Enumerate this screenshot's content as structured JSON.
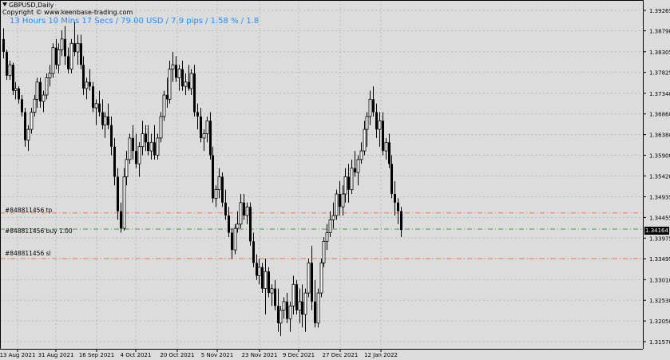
{
  "header": {
    "symbol_timeframe": "GBPUSD,Daily",
    "copyright": "Copyright © www.keenbase-trading.com",
    "timer_info": "13 Hours 10 Mins 17 Secs / 79.00 USD / 7.9 pips / 1.58 % / 1.8"
  },
  "price_axis": {
    "labels": [
      "1.39265",
      "1.38790",
      "1.38305",
      "1.37825",
      "1.37340",
      "1.36860",
      "1.36380",
      "1.35900",
      "1.35420",
      "1.34935",
      "1.34455",
      "1.33975",
      "1.33495",
      "1.33010",
      "1.32530",
      "1.32050",
      "1.31570"
    ],
    "current_price": "1.34164"
  },
  "time_axis": {
    "labels": [
      "13 Aug 2021",
      "31 Aug 2021",
      "16 Sep 2021",
      "4 Oct 2021",
      "20 Oct 2021",
      "5 Nov 2021",
      "23 Nov 2021",
      "9 Dec 2021",
      "27 Dec 2021",
      "12 Jan 2022"
    ]
  },
  "order_lines": [
    {
      "label": "#848811456 tp",
      "price": 1.3456,
      "color": "#f0784a"
    },
    {
      "label": "#848811456 buy 1.00",
      "price": 1.34185,
      "color": "#3aa53a"
    },
    {
      "label": "#848811456 sl",
      "price": 1.335,
      "color": "#f0784a"
    }
  ],
  "colors": {
    "background": "#dcdcdc",
    "grid": "#b8b8b8",
    "candle": "#000000",
    "axis": "#000000"
  },
  "chart_data": {
    "type": "candlestick",
    "symbol": "GBPUSD",
    "timeframe": "Daily",
    "ylim": [
      1.3137,
      1.3941
    ],
    "ohlc": [
      [
        1.386,
        1.3885,
        1.3815,
        1.383
      ],
      [
        1.383,
        1.3835,
        1.3765,
        1.3775
      ],
      [
        1.3775,
        1.381,
        1.3765,
        1.38
      ],
      [
        1.38,
        1.3805,
        1.373,
        1.374
      ],
      [
        1.374,
        1.376,
        1.372,
        1.3745
      ],
      [
        1.3745,
        1.375,
        1.371,
        1.372
      ],
      [
        1.372,
        1.373,
        1.368,
        1.369
      ],
      [
        1.369,
        1.37,
        1.361,
        1.3625
      ],
      [
        1.3625,
        1.366,
        1.36,
        1.365
      ],
      [
        1.365,
        1.37,
        1.364,
        1.369
      ],
      [
        1.369,
        1.373,
        1.368,
        1.372
      ],
      [
        1.372,
        1.377,
        1.37,
        1.376
      ],
      [
        1.376,
        1.377,
        1.37,
        1.3715
      ],
      [
        1.3715,
        1.374,
        1.369,
        1.373
      ],
      [
        1.373,
        1.378,
        1.372,
        1.377
      ],
      [
        1.377,
        1.38,
        1.375,
        1.378
      ],
      [
        1.378,
        1.385,
        1.377,
        1.384
      ],
      [
        1.384,
        1.386,
        1.379,
        1.38
      ],
      [
        1.38,
        1.385,
        1.378,
        1.3835
      ],
      [
        1.3835,
        1.388,
        1.382,
        1.386
      ],
      [
        1.386,
        1.389,
        1.38,
        1.382
      ],
      [
        1.382,
        1.384,
        1.378,
        1.379
      ],
      [
        1.379,
        1.386,
        1.378,
        1.385
      ],
      [
        1.385,
        1.39,
        1.382,
        1.383
      ],
      [
        1.383,
        1.387,
        1.38,
        1.385
      ],
      [
        1.385,
        1.387,
        1.379,
        1.38
      ],
      [
        1.38,
        1.382,
        1.373,
        1.3745
      ],
      [
        1.3745,
        1.377,
        1.372,
        1.376
      ],
      [
        1.376,
        1.379,
        1.374,
        1.375
      ],
      [
        1.375,
        1.376,
        1.369,
        1.37
      ],
      [
        1.37,
        1.372,
        1.366,
        1.371
      ],
      [
        1.371,
        1.374,
        1.368,
        1.369
      ],
      [
        1.369,
        1.372,
        1.365,
        1.366
      ],
      [
        1.366,
        1.369,
        1.363,
        1.368
      ],
      [
        1.368,
        1.371,
        1.365,
        1.366
      ],
      [
        1.366,
        1.368,
        1.359,
        1.361
      ],
      [
        1.361,
        1.363,
        1.352,
        1.354
      ],
      [
        1.354,
        1.356,
        1.344,
        1.346
      ],
      [
        1.346,
        1.348,
        1.341,
        1.342
      ],
      [
        1.342,
        1.356,
        1.3415,
        1.354
      ],
      [
        1.354,
        1.36,
        1.352,
        1.358
      ],
      [
        1.358,
        1.364,
        1.357,
        1.363
      ],
      [
        1.363,
        1.366,
        1.358,
        1.36
      ],
      [
        1.36,
        1.364,
        1.356,
        1.357
      ],
      [
        1.357,
        1.362,
        1.354,
        1.361
      ],
      [
        1.361,
        1.367,
        1.359,
        1.364
      ],
      [
        1.364,
        1.366,
        1.36,
        1.362
      ],
      [
        1.362,
        1.366,
        1.359,
        1.36
      ],
      [
        1.36,
        1.364,
        1.358,
        1.362
      ],
      [
        1.362,
        1.366,
        1.358,
        1.359
      ],
      [
        1.359,
        1.364,
        1.358,
        1.363
      ],
      [
        1.363,
        1.369,
        1.362,
        1.368
      ],
      [
        1.368,
        1.374,
        1.367,
        1.373
      ],
      [
        1.373,
        1.377,
        1.37,
        1.372
      ],
      [
        1.372,
        1.381,
        1.371,
        1.379
      ],
      [
        1.379,
        1.383,
        1.376,
        1.38
      ],
      [
        1.38,
        1.382,
        1.376,
        1.377
      ],
      [
        1.377,
        1.38,
        1.374,
        1.379
      ],
      [
        1.379,
        1.381,
        1.374,
        1.375
      ],
      [
        1.375,
        1.378,
        1.373,
        1.376
      ],
      [
        1.376,
        1.38,
        1.374,
        1.3745
      ],
      [
        1.3745,
        1.379,
        1.373,
        1.378
      ],
      [
        1.378,
        1.38,
        1.368,
        1.369
      ],
      [
        1.369,
        1.371,
        1.365,
        1.368
      ],
      [
        1.368,
        1.37,
        1.362,
        1.363
      ],
      [
        1.363,
        1.365,
        1.36,
        1.364
      ],
      [
        1.364,
        1.368,
        1.362,
        1.367
      ],
      [
        1.367,
        1.369,
        1.358,
        1.359
      ],
      [
        1.359,
        1.361,
        1.348,
        1.349
      ],
      [
        1.349,
        1.352,
        1.347,
        1.351
      ],
      [
        1.351,
        1.356,
        1.349,
        1.354
      ],
      [
        1.354,
        1.355,
        1.347,
        1.348
      ],
      [
        1.348,
        1.351,
        1.344,
        1.345
      ],
      [
        1.345,
        1.347,
        1.34,
        1.341
      ],
      [
        1.341,
        1.342,
        1.335,
        1.337
      ],
      [
        1.337,
        1.343,
        1.336,
        1.342
      ],
      [
        1.342,
        1.346,
        1.341,
        1.343
      ],
      [
        1.343,
        1.35,
        1.342,
        1.348
      ],
      [
        1.348,
        1.35,
        1.344,
        1.345
      ],
      [
        1.345,
        1.348,
        1.343,
        1.347
      ],
      [
        1.347,
        1.348,
        1.338,
        1.339
      ],
      [
        1.339,
        1.341,
        1.333,
        1.334
      ],
      [
        1.334,
        1.336,
        1.33,
        1.331
      ],
      [
        1.331,
        1.335,
        1.329,
        1.333
      ],
      [
        1.333,
        1.334,
        1.327,
        1.328
      ],
      [
        1.328,
        1.335,
        1.322,
        1.332
      ],
      [
        1.332,
        1.333,
        1.326,
        1.327
      ],
      [
        1.327,
        1.329,
        1.324,
        1.328
      ],
      [
        1.328,
        1.33,
        1.323,
        1.324
      ],
      [
        1.324,
        1.328,
        1.318,
        1.32
      ],
      [
        1.32,
        1.324,
        1.317,
        1.323
      ],
      [
        1.323,
        1.326,
        1.321,
        1.325
      ],
      [
        1.325,
        1.327,
        1.32,
        1.321
      ],
      [
        1.321,
        1.325,
        1.318,
        1.324
      ],
      [
        1.324,
        1.331,
        1.322,
        1.329
      ],
      [
        1.329,
        1.33,
        1.322,
        1.323
      ],
      [
        1.323,
        1.328,
        1.32,
        1.325
      ],
      [
        1.325,
        1.329,
        1.319,
        1.322
      ],
      [
        1.322,
        1.328,
        1.318,
        1.327
      ],
      [
        1.327,
        1.335,
        1.326,
        1.334
      ],
      [
        1.334,
        1.338,
        1.323,
        1.325
      ],
      [
        1.325,
        1.33,
        1.319,
        1.32
      ],
      [
        1.32,
        1.328,
        1.319,
        1.327
      ],
      [
        1.327,
        1.335,
        1.326,
        1.334
      ],
      [
        1.334,
        1.34,
        1.333,
        1.339
      ],
      [
        1.339,
        1.343,
        1.337,
        1.341
      ],
      [
        1.341,
        1.346,
        1.34,
        1.344
      ],
      [
        1.344,
        1.348,
        1.342,
        1.345
      ],
      [
        1.345,
        1.351,
        1.344,
        1.35
      ],
      [
        1.35,
        1.353,
        1.345,
        1.347
      ],
      [
        1.347,
        1.352,
        1.345,
        1.35
      ],
      [
        1.35,
        1.356,
        1.348,
        1.354
      ],
      [
        1.354,
        1.357,
        1.348,
        1.351
      ],
      [
        1.351,
        1.358,
        1.35,
        1.356
      ],
      [
        1.356,
        1.36,
        1.354,
        1.355
      ],
      [
        1.355,
        1.359,
        1.352,
        1.358
      ],
      [
        1.358,
        1.362,
        1.357,
        1.36
      ],
      [
        1.36,
        1.367,
        1.359,
        1.365
      ],
      [
        1.365,
        1.369,
        1.361,
        1.368
      ],
      [
        1.368,
        1.374,
        1.366,
        1.372
      ],
      [
        1.372,
        1.375,
        1.368,
        1.369
      ],
      [
        1.369,
        1.371,
        1.363,
        1.365
      ],
      [
        1.365,
        1.369,
        1.361,
        1.367
      ],
      [
        1.367,
        1.369,
        1.359,
        1.36
      ],
      [
        1.36,
        1.363,
        1.358,
        1.362
      ],
      [
        1.362,
        1.364,
        1.356,
        1.357
      ],
      [
        1.357,
        1.359,
        1.349,
        1.35
      ],
      [
        1.35,
        1.353,
        1.345,
        1.348
      ],
      [
        1.348,
        1.349,
        1.343,
        1.346
      ],
      [
        1.346,
        1.347,
        1.34,
        1.3416
      ]
    ]
  }
}
